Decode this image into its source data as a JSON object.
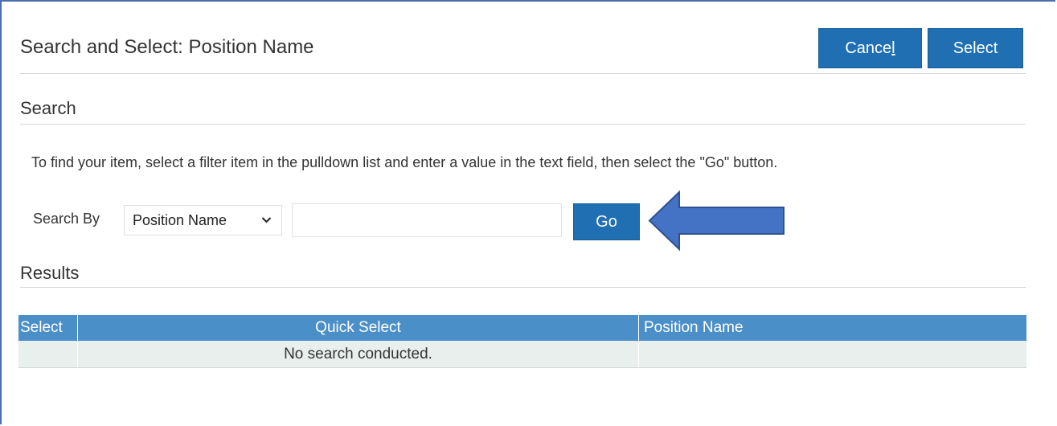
{
  "dialog": {
    "title": "Search and Select: Position Name",
    "cancel_label_pre": "Cance",
    "cancel_label_underline": "l",
    "select_label": "Select"
  },
  "search": {
    "section_title": "Search",
    "instructions": "To find your item, select a filter item in the pulldown list and enter a value in the text field, then select the \"Go\" button.",
    "search_by_label": "Search By",
    "filter_selected": "Position Name",
    "value": "",
    "go_label": "Go"
  },
  "results": {
    "section_title": "Results",
    "columns": [
      "Select",
      "Quick Select",
      "Position Name"
    ],
    "empty_message": "No search conducted."
  },
  "icons": {
    "dropdown": "chevron-down-icon",
    "annotation": "arrow-left-icon"
  },
  "colors": {
    "button": "#1f6fb2",
    "table_header": "#4b8fc8",
    "table_row": "#e9efec",
    "annotation_arrow": "#4472c4"
  }
}
